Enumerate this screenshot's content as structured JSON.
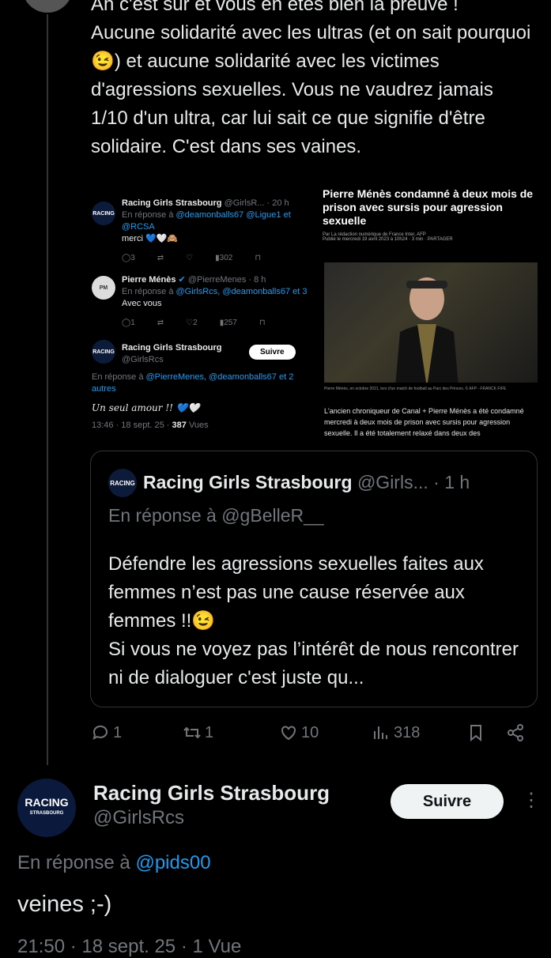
{
  "main_tweet": {
    "text": "Ah c'est sur et vous en êtes bien la preuve !\nAucune solidarité avec les ultras (et on sait pourquoi😉) et aucune solidarité avec les victimes d'agressions sexuelles. Vous ne vaudrez jamais 1/10 d'un ultra, car lui sait ce que signifie d'être solidaire. C'est dans ses vaines."
  },
  "collage": {
    "tweet1": {
      "name": "Racing Girls Strasbourg",
      "handle": "@GirlsR... · 20 h",
      "reply_prefix": "En réponse à",
      "reply_handles": "@deamonballs67 @Ligue1 et @RCSA",
      "text": "merci 💙🤍🙈",
      "replies": "3",
      "views": "302"
    },
    "tweet2": {
      "name": "Pierre Ménès",
      "handle": "@PierreMenes · 8 h",
      "reply_prefix": "En réponse à",
      "reply_handles": "@GirlsRcs, @deamonballs67 et 3",
      "text": "Avec vous",
      "replies": "1",
      "likes": "2",
      "views": "257"
    },
    "tweet3": {
      "name": "Racing Girls Strasbourg",
      "handle": "@GirlsRcs",
      "follow": "Suivre",
      "reply_prefix": "En réponse à",
      "reply_handles": "@PierreMenes, @deamonballs67 et 2 autres",
      "text": "Un seul amour !! 💙🤍",
      "time": "13:46 · 18 sept. 25 ·",
      "views": "387",
      "views_label": "Vues"
    },
    "article": {
      "title": "Pierre Ménès condamné à deux mois de prison avec sursis pour agression sexuelle",
      "byline": "Par La rédaction numérique de France Inter, AFP",
      "meta": "Publié le mercredi 19 avril 2023 à 10h24 · 3 min · PARTAGER",
      "caption": "Pierre Ménès, en octobre 2021, lors d'un match de football au Parc des Princes. © AFP - FRANCK FIFE",
      "body": "L'ancien chroniqueur de Canal + Pierre Ménès a été condamné mercredi à deux mois de prison avec sursis pour agression sexuelle. Il a été totalement relaxé dans deux des"
    }
  },
  "quote": {
    "avatar_text": "RACING",
    "name": "Racing Girls Strasbourg",
    "handle": "@Girls...",
    "time": "· 1 h",
    "reply": "En réponse à @gBelleR__",
    "body": "Défendre les agressions sexuelles faites aux femmes n’est pas une cause réservée aux femmes !!😉\nSi vous ne voyez pas l’intérêt de nous rencontrer ni de dialoguer c'est juste qu..."
  },
  "actions": {
    "replies": "1",
    "reposts": "1",
    "likes": "10",
    "views": "318"
  },
  "bottom_tweet": {
    "avatar_text": "RACING",
    "avatar_sub": "STRASBOURG",
    "name": "Racing Girls Strasbourg",
    "handle": "@GirlsRcs",
    "follow": "Suivre",
    "more": "⋮",
    "reply_prefix": "En réponse à",
    "reply_handle": "@pids00",
    "text": "veines ;-)",
    "time": "21:50 · 18 sept. 25 · 1 Vue"
  },
  "colors": {
    "background": "#000000",
    "text": "#e7e9ea",
    "muted": "#71767b",
    "link": "#1d9bf0",
    "border": "#2f3336"
  }
}
